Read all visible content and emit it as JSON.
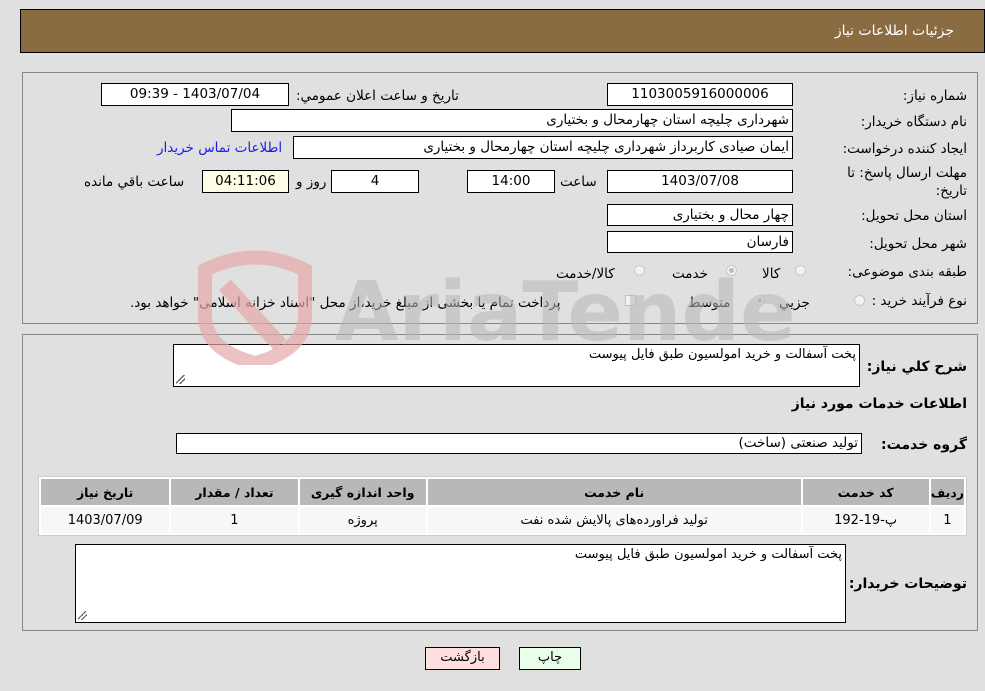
{
  "header": {
    "title": "جزئیات اطلاعات نیاز"
  },
  "form": {
    "need_number": {
      "label": "شماره نیاز:",
      "value": "1103005916000006"
    },
    "announce_datetime": {
      "label": "تاریخ و ساعت اعلان عمومي:",
      "value": "1403/07/04 - 09:39"
    },
    "buyer_org": {
      "label": "نام دستگاه خریدار:",
      "value": "شهرداری چلیچه استان چهارمحال و بختیاری"
    },
    "requester": {
      "label": "ایجاد کننده درخواست:",
      "value": "ایمان صیادی کاربرداز شهرداری چلیچه استان چهارمحال و بختیاری"
    },
    "buyer_contact_link": "اطلاعات تماس خریدار",
    "deadline": {
      "label_line1": "مهلت ارسال پاسخ: تا",
      "label_line2": "تاریخ:",
      "date": "1403/07/08",
      "time_label": "ساعت",
      "time": "14:00",
      "days": "4",
      "days_label": "روز و",
      "remaining": "04:11:06",
      "remaining_label": "ساعت باقي مانده"
    },
    "province": {
      "label": "استان محل تحویل:",
      "value": "چهار محال و بختیاری"
    },
    "city": {
      "label": "شهر محل تحویل:",
      "value": "فارسان"
    },
    "category": {
      "label": "طبقه بندی موضوعی:",
      "options": [
        "کالا",
        "خدمت",
        "کالا/خدمت"
      ],
      "selected": "خدمت"
    },
    "purchase_type": {
      "label": "نوع فرآیند خرید :",
      "options": [
        "جزیي",
        "متوسط"
      ],
      "selected": "متوسط",
      "treasury_note": "پرداخت تمام یا بخشی از مبلغ خرید،از محل \"اسناد خزانه اسلامی\" خواهد بود."
    }
  },
  "details": {
    "general_desc_label": "شرح کلي نياز:",
    "general_desc": "پخت آسفالت و خرید امولسیون طبق فایل پیوست",
    "services_title": "اطلاعات خدمات مورد نياز",
    "service_group_label": "گروه خدمت:",
    "service_group": "تولید صنعتی (ساخت)",
    "table": {
      "headers": [
        "ردیف",
        "کد خدمت",
        "نام خدمت",
        "واحد اندازه گیری",
        "تعداد / مقدار",
        "تاریخ نیاز"
      ],
      "rows": [
        [
          "1",
          "پ-19-192",
          "تولید فراورده‌های پالایش شده نفت",
          "پروژه",
          "1",
          "1403/07/09"
        ]
      ]
    },
    "buyer_notes_label": "توضیحات خریدار:",
    "buyer_notes": "پخت آسفالت و خرید امولسیون طبق فایل پیوست"
  },
  "buttons": {
    "print": "چاپ",
    "back": "بازگشت"
  },
  "watermark": "AriaTender.neT",
  "colors": {
    "header_bg": "#8b6b41",
    "link": "#1a1aee",
    "print_bg": "#eaffea",
    "back_bg": "#ffdede",
    "remaining_bg": "#fefee6"
  }
}
